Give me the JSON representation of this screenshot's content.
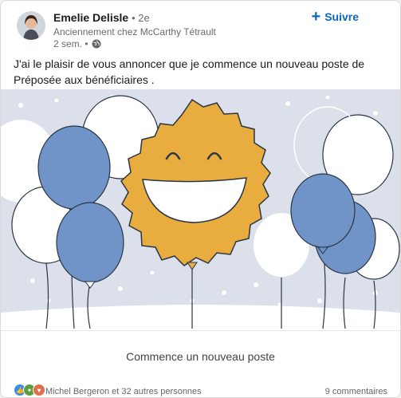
{
  "author": {
    "name": "Emelie Delisle",
    "degree": "• 2e",
    "headline": "Anciennement chez McCarthy Tétrault",
    "time": "2 sem. •",
    "visibility_icon": "globe-icon"
  },
  "actions": {
    "follow_label": "Suivre"
  },
  "post": {
    "text": "J'ai le plaisir de vous annoncer que je commence un nouveau poste de Préposée aux bénéficiaires  ."
  },
  "image": {
    "caption": "Commence un nouveau poste"
  },
  "social": {
    "reactors": "Michel Bergeron et 32 autres personnes",
    "comments": "9 commentaires"
  },
  "colors": {
    "accent": "#0a66c2",
    "sun": "#e9ad3f",
    "balloon_blue": "#7093c8",
    "background": "#dbe0ea"
  }
}
